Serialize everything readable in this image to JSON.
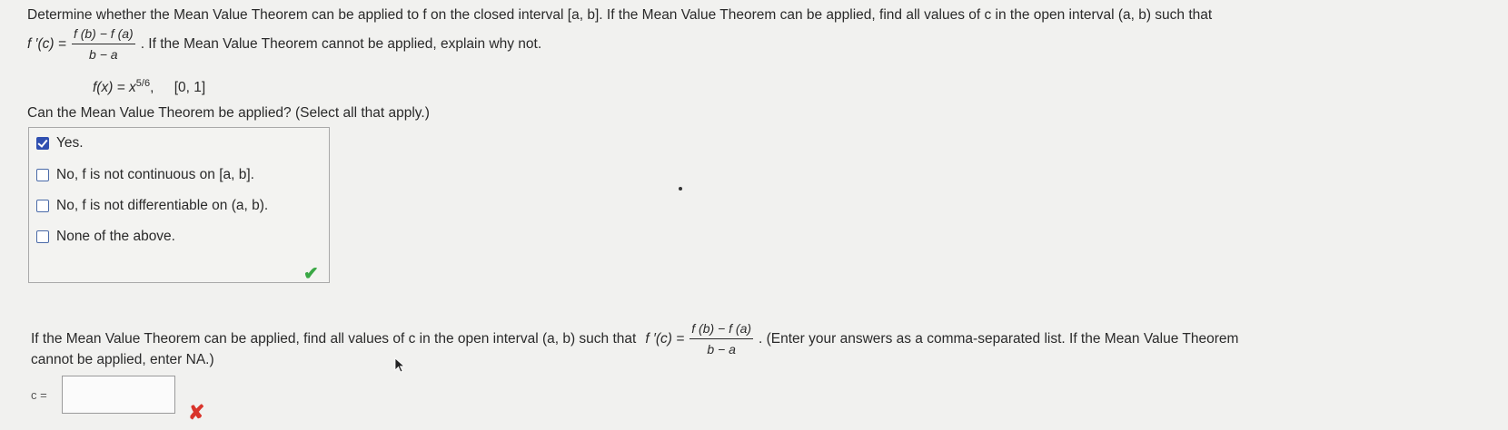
{
  "question": {
    "line1": "Determine whether the Mean Value Theorem can be applied to f on the closed interval [a, b]. If the Mean Value Theorem can be applied, find all values of c in the open interval (a, b) such that",
    "lhs": "f ′(c) =",
    "frac_num": "f (b) − f (a)",
    "frac_den": "b − a",
    "line2_tail": ". If the Mean Value Theorem cannot be applied, explain why not.",
    "function_text": "f(x) = x",
    "exponent": "5/6",
    "interval": "[0, 1]"
  },
  "part1": {
    "prompt": "Can the Mean Value Theorem be applied? (Select all that apply.)",
    "options": [
      {
        "label": "Yes.",
        "checked": true
      },
      {
        "label": "No, f is not continuous on [a, b].",
        "checked": false
      },
      {
        "label": "No, f is not differentiable on (a, b).",
        "checked": false
      },
      {
        "label": "None of the above.",
        "checked": false
      }
    ],
    "status_icon": "check-icon",
    "status_color": "#3aa845"
  },
  "part2": {
    "prompt_a": "If the Mean Value Theorem can be applied, find all values of c in the open interval (a, b) such that",
    "lhs": "f ′(c) =",
    "frac_num": "f (b) − f (a)",
    "frac_den": "b − a",
    "prompt_b": ". (Enter your answers as a comma-separated list. If the Mean Value Theorem",
    "prompt_c": "cannot be applied, enter NA.)",
    "answer_label": "c =",
    "answer_value": "",
    "status_icon": "x-mark-icon",
    "status_color": "#d9342b"
  }
}
